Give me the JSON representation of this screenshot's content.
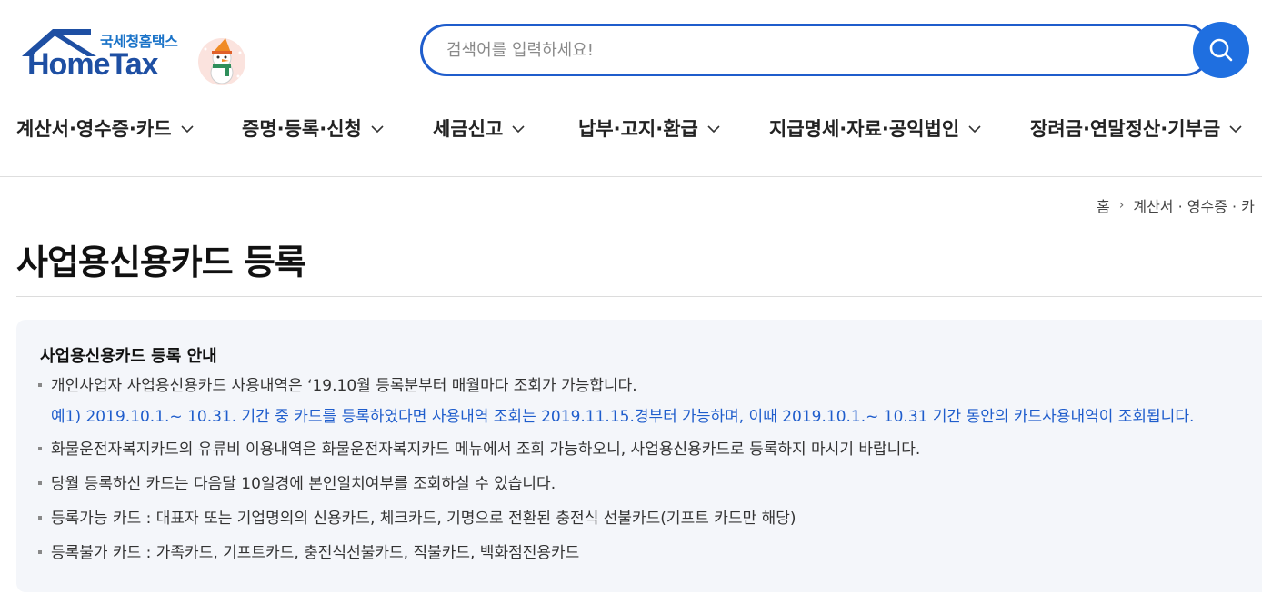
{
  "header": {
    "logo_sub": "국세청홈택스",
    "logo_main": "HomeTax",
    "search_placeholder": "검색어를 입력하세요!",
    "accent_color": "#1f6fe0"
  },
  "gnb": [
    {
      "label": "계산서·영수증·카드"
    },
    {
      "label": "증명·등록·신청"
    },
    {
      "label": "세금신고"
    },
    {
      "label": "납부·고지·환급"
    },
    {
      "label": "지급명세·자료·공익법인"
    },
    {
      "label": "장려금·연말정산·기부금"
    }
  ],
  "breadcrumb": {
    "home": "홈",
    "current": "계산서 · 영수증 · 카"
  },
  "page": {
    "title": "사업용신용카드 등록"
  },
  "notice": {
    "title": "사업용신용카드 등록 안내",
    "item1": "개인사업자 사업용신용카드 사용내역은 ‘19.10월 등록분부터 매월마다 조회가 가능합니다.",
    "item1_sub": "예1) 2019.10.1.~ 10.31. 기간 중 카드를 등록하였다면 사용내역 조회는 2019.11.15.경부터 가능하며, 이때 2019.10.1.~ 10.31 기간 동안의 카드사용내역이 조회됩니다.",
    "item2": "화물운전자복지카드의 유류비 이용내역은 화물운전자복지카드 메뉴에서 조회 가능하오니, 사업용신용카드로 등록하지 마시기 바랍니다.",
    "item3": "당월 등록하신 카드는 다음달 10일경에 본인일치여부를 조회하실 수 있습니다.",
    "item4": "등록가능 카드 : 대표자 또는 기업명의의 신용카드, 체크카드, 기명으로 전환된 충전식 선불카드(기프트 카드만 해당)",
    "item5": "등록불가 카드 : 가족카드, 기프트카드, 충전식선불카드, 직불카드, 백화점전용카드"
  }
}
